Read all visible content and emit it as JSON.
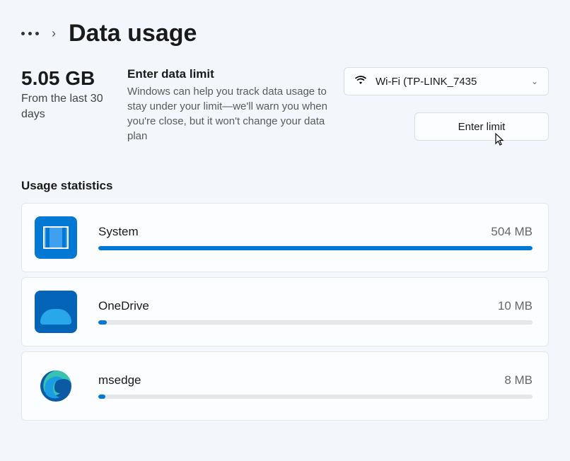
{
  "page": {
    "title": "Data usage"
  },
  "summary": {
    "total": "5.05 GB",
    "period": "From the last 30 days"
  },
  "limit": {
    "heading": "Enter data limit",
    "description": "Windows can help you track data usage to stay under your limit—we'll warn you when you're close, but it won't change your data plan",
    "button": "Enter limit"
  },
  "network": {
    "name": "Wi-Fi (TP-LINK_7435"
  },
  "stats": {
    "heading": "Usage statistics",
    "items": [
      {
        "name": "System",
        "size": "504 MB",
        "pct": 100
      },
      {
        "name": "OneDrive",
        "size": "10 MB",
        "pct": 2
      },
      {
        "name": "msedge",
        "size": "8 MB",
        "pct": 1.6
      }
    ]
  }
}
